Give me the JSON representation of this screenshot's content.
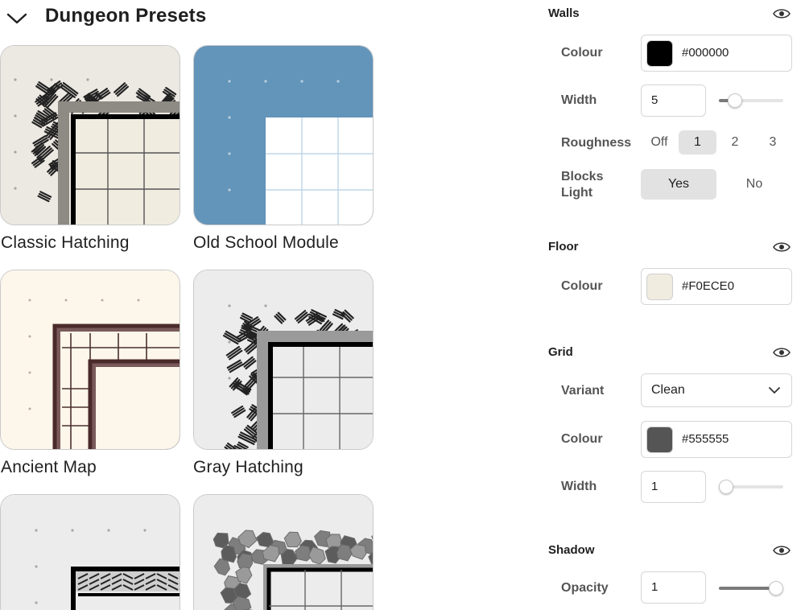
{
  "presets": {
    "title": "Dungeon Presets",
    "items": [
      {
        "label": "Classic Hatching"
      },
      {
        "label": "Old School Module"
      },
      {
        "label": "Ancient Map"
      },
      {
        "label": "Gray Hatching"
      },
      {
        "label": ""
      },
      {
        "label": ""
      }
    ]
  },
  "settings": {
    "walls": {
      "title": "Walls",
      "colour_label": "Colour",
      "colour_value": "#000000",
      "colour_swatch": "#000000",
      "width_label": "Width",
      "width_value": "5",
      "width_slider_fraction": 0.25,
      "roughness_label": "Roughness",
      "roughness_options": [
        "Off",
        "1",
        "2",
        "3"
      ],
      "roughness_selected": "1",
      "blocks_light_label_line1": "Blocks",
      "blocks_light_label_line2": "Light",
      "blocks_light_yes": "Yes",
      "blocks_light_no": "No",
      "blocks_light_selected": "Yes"
    },
    "floor": {
      "title": "Floor",
      "colour_label": "Colour",
      "colour_value": "#F0ECE0",
      "colour_swatch": "#F0ECE0"
    },
    "grid": {
      "title": "Grid",
      "variant_label": "Variant",
      "variant_value": "Clean",
      "colour_label": "Colour",
      "colour_value": "#555555",
      "colour_swatch": "#555555",
      "width_label": "Width",
      "width_value": "1",
      "width_slider_fraction": 0.0
    },
    "shadow": {
      "title": "Shadow",
      "opacity_label": "Opacity",
      "opacity_value": "1",
      "opacity_slider_fraction": 1.0
    }
  },
  "colors": {
    "classic_bg": "#ECE8E2",
    "old_school_blue": "#6394B9",
    "ancient_bg": "#FDF6EA",
    "ancient_wall": "#5A3A3A",
    "gray_bg": "#ECECEC"
  },
  "icons": {
    "collapse": "chevron-down-icon",
    "visibility": "eye-icon",
    "dropdown": "chevron-down-icon"
  }
}
